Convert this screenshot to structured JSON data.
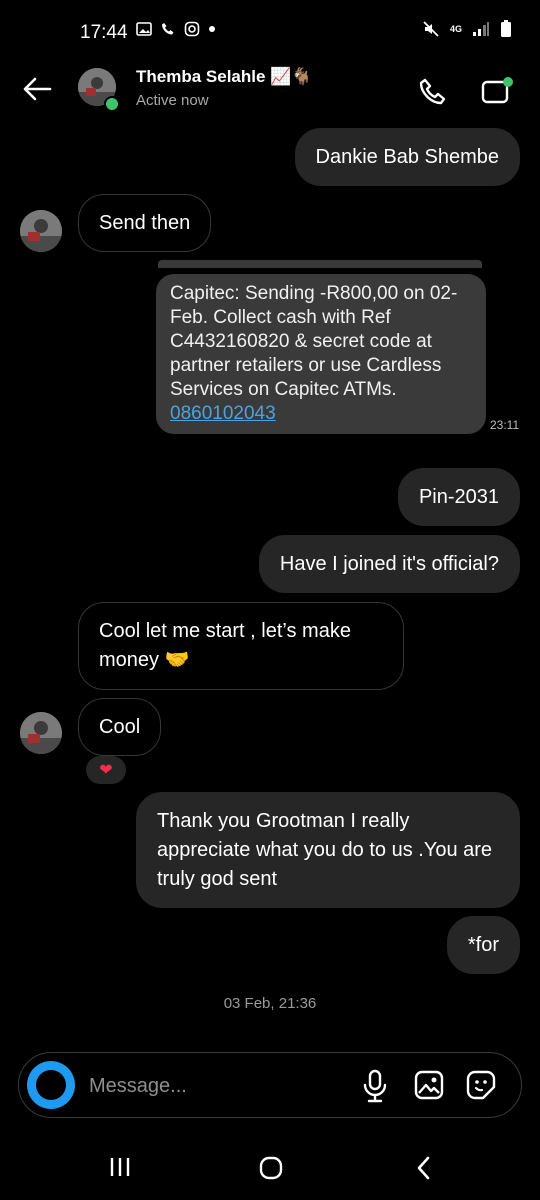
{
  "status_bar": {
    "time": "17:44",
    "network": "4G"
  },
  "header": {
    "name": "Themba Selahle",
    "name_emoji": "📈🐐",
    "status": "Active now"
  },
  "messages": [
    {
      "from": "me",
      "text": "Dankie Bab Shembe"
    },
    {
      "from": "them",
      "text": "Send then"
    },
    {
      "from": "them",
      "type": "sms_screenshot",
      "text": "Capitec: Sending -R800,00 on 02-Feb. Collect cash with Ref C4432160820 & secret code at partner retailers or use Cardless Services on Capitec ATMs.",
      "link": "0860102043",
      "time": "23:11"
    },
    {
      "from": "me",
      "text": "Pin-2031"
    },
    {
      "from": "me",
      "text": "Have I joined it's official?"
    },
    {
      "from": "them",
      "text": "Cool let me start , let’s make money 🤝"
    },
    {
      "from": "them",
      "text": "Cool",
      "reaction": "❤"
    },
    {
      "from": "me",
      "text": "Thank you Grootman I really appreciate what you do to us .You are truly god sent"
    },
    {
      "from": "me",
      "text": "*for"
    }
  ],
  "timestamp": "03 Feb, 21:36",
  "composer": {
    "placeholder": "Message..."
  },
  "colors": {
    "bubble_me": "#262626",
    "link": "#4aa3e0",
    "online": "#3ec46d",
    "camera": "#1e9bf0"
  }
}
